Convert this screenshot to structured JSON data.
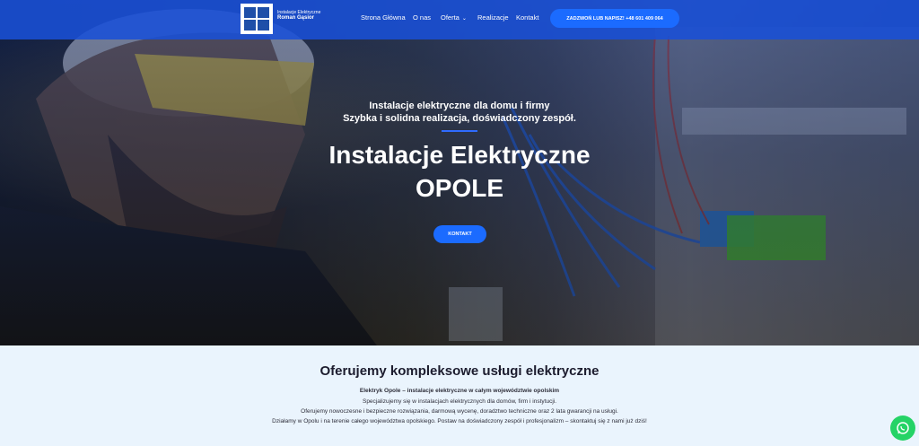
{
  "header": {
    "logo_line1": "Instalacje Elektryczne",
    "logo_line2": "Roman Gąsior",
    "nav": [
      {
        "label": "Strona Główna"
      },
      {
        "label": "O nas"
      },
      {
        "label": "Oferta"
      },
      {
        "label": "Realizacje"
      },
      {
        "label": "Kontakt"
      }
    ],
    "cta_label": "ZADZWOŃ LUB NAPISZ! +48 601 409 064"
  },
  "hero": {
    "subtitle_line1": "Instalacje elektryczne dla domu i firmy",
    "subtitle_line2": "Szybka i solidna realizacja, doświadczony zespół.",
    "title_line1": "Instalacje Elektryczne",
    "title_line2": "OPOLE",
    "button_label": "KONTAKT"
  },
  "services": {
    "title": "Oferujemy kompleksowe usługi elektryczne",
    "line1": "Elektryk Opole – instalacje elektryczne w całym województwie opolskim",
    "line2": "Specjalizujemy się w instalacjach elektrycznych dla domów, firm i instytucji.",
    "line3": "Oferujemy nowoczesne i bezpieczne rozwiązania, darmową wycenę, doradztwo techniczne oraz 2 lata gwarancji na usługi.",
    "line4": "Działamy w Opolu i na terenie całego województwa opolskiego. Postaw na doświadczony zespół i profesjonalizm – skontaktuj się z nami już dziś!"
  },
  "colors": {
    "nav_bg": "#1950d7",
    "accent": "#1b6bff",
    "whatsapp": "#25d366"
  }
}
